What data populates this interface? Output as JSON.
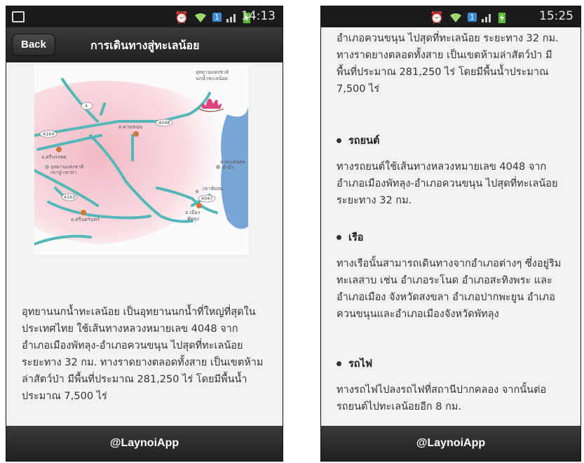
{
  "left": {
    "status": {
      "time": "14:13",
      "battery": "8"
    },
    "back_label": "Back",
    "title": "การเดินทางสู่ทะเลน้อย",
    "map": {
      "park_label_1": "อุทยานแห่งชาติ",
      "park_label_2": "นกน้ำทะเลน้อย",
      "road_4": "4",
      "road_4048": "4048",
      "road_4164": "4164",
      "road_4163": "4163",
      "road_4047": "4047",
      "khuan_khanun": "อ.ควนขนุน",
      "si_banphot": "อ.ศรีบรรพต",
      "khao_pu": "อุทยานแห่งชาติ",
      "khao_pu_2": "เขาปู่-เขาย่า",
      "hat_lae_1": "หาดแสนสุข",
      "hat_lae_2": "ลำปำ",
      "khok_pho": "เขาชัยสน",
      "si_nakharin": "อ.ศรีนครินทร์",
      "mueang_1": "อ.เมือง",
      "mueang_2": "พัทลุง"
    },
    "paragraph": "อุทยานนกน้ำทะเลน้อย เป็นอุทยานนกน้ำที่ใหญ่ที่สุดในประเทศไทย ใช้เส้นทางหลวงหมายเลข 4048 จากอำเภอเมืองพัทลุง-อำเภอควนขนุน ไปสุดที่ทะเลน้อย ระยะทาง 32 กม. ทางราดยางตลอดทั้งสาย เป็นเขตห้ามล่าสัตว์ป่า มีพื้นที่ประมาณ 281,250 ไร่ โดยมีพื้นน้ำประมาณ 7,500 ไร่",
    "footer": "@LaynoiApp"
  },
  "right": {
    "status": {
      "time": "15:25"
    },
    "top_para": "อำเภอควนขนุน ไปสุดที่ทะเลน้อย ระยะทาง 32 กม. ทางราดยางตลอดทั้งสาย เป็นเขตห้ามล่าสัตว์ป่า มีพื้นที่ประมาณ 281,250 ไร่ โดยมีพื้นน้ำประมาณ 7,500 ไร่",
    "sections": [
      {
        "heading": "รถยนต์",
        "body": "ทางรถยนต์ใช้เส้นทางหลวงหมายเลข 4048 จากอำเภอเมืองพัทลุง-อำเภอควนขนุน ไปสุดที่ทะเลน้อยระยะทาง 32 กม."
      },
      {
        "heading": "เรือ",
        "body": "ทางเรือนั้นสามารถเดินทางจากอำเภอต่างๆ ซึ่งอยู่ริมทะเลสาบ เช่น อำเภอระโนด อำเภอสะทิงพระ และอำเภอเมือง จังหวัดสงขลา อำเภอปากพะยูน อำเภอควนขนุนและอำเภอเมืองจังหวัดพัทลุง"
      },
      {
        "heading": "รถไฟ",
        "body": "ทางรถไฟไปลงรถไฟที่สถานีปากคลอง จากนั้นต่อรถยนต์ไปทะเลน้อยอีก 8 กม."
      }
    ],
    "footer": "@LaynoiApp"
  },
  "colors": {
    "road": "#56b7b8",
    "town": "#d2773c",
    "water": "#7aa6d6",
    "pink": "#f5c6cf"
  },
  "icons": [
    "image-icon",
    "alarm-icon",
    "wifi-icon",
    "signal-icon",
    "battery-icon",
    "lotus-icon"
  ]
}
